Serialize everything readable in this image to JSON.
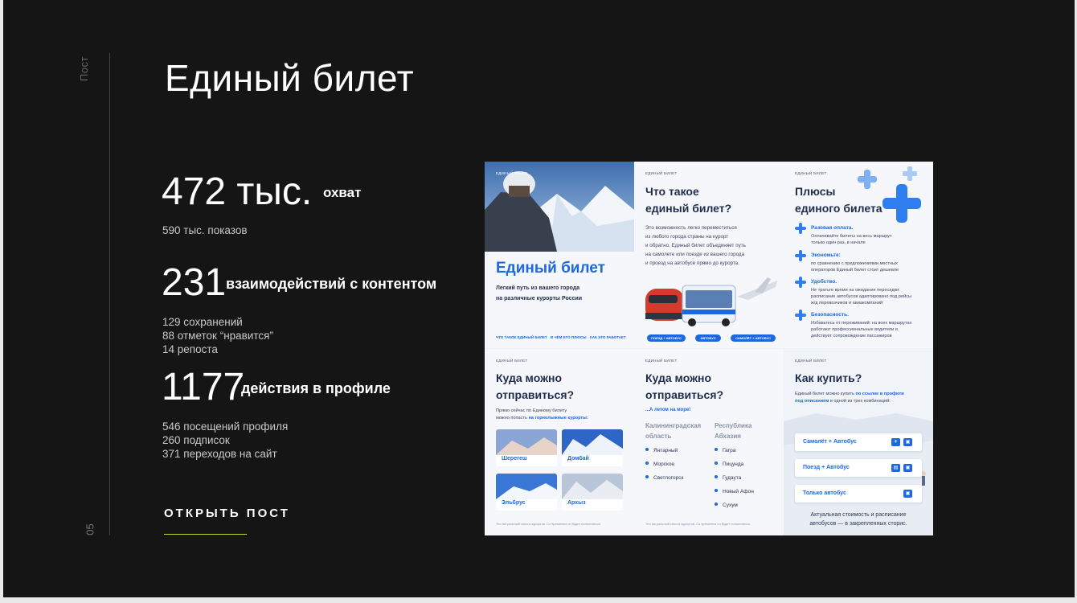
{
  "side": {
    "label": "Пост",
    "number": "05"
  },
  "title": "Единый билет",
  "stats": [
    {
      "value": "472 тыс.",
      "caption": "охват",
      "details": [
        "590 тыс. показов"
      ]
    },
    {
      "value": "231",
      "caption": "взаимодействий с контентом",
      "details": [
        "129 сохранений",
        "88 отметок “нравится”",
        "14 репоста"
      ]
    },
    {
      "value": "1177",
      "caption": "действия в профиле",
      "details": [
        "546 посещений профиля",
        "260 подписок",
        "371 переходов на сайт"
      ]
    }
  ],
  "open_post": "ОТКРЫТЬ ПОСТ",
  "colors": {
    "background": "#151515",
    "accent_underline": "#c6d639",
    "collage_blue": "#1b68e0"
  },
  "collage": {
    "tag": "ЕДИНЫЙ БИЛЕТ",
    "cover": {
      "title": "Единый билет",
      "subtitle_1": "Легкий путь из вашего города",
      "subtitle_2": "на различные курорты России",
      "links": [
        "ЧТО ТАКОЕ ЕДИНЫЙ БИЛЕТ",
        "В ЧЁМ ЕГО ПЛЮСЫ",
        "КАК ЭТО РАБОТАЕТ"
      ]
    },
    "what": {
      "heading_1": "Что такое",
      "heading_2": "единый билет?",
      "text": [
        "Это возможность легко переместиться",
        "из любого города страны на курорт",
        "и обратно. Единый билет объединяет путь",
        "на самолете или поезде из вашего города",
        "и проезд на автобусе прямо до курорта."
      ],
      "pills": [
        "ПОЕЗД + АВТОБУС",
        "АВТОБУС",
        "САМОЛЁТ + АВТОБУС"
      ]
    },
    "plus": {
      "heading_1": "Плюсы",
      "heading_2": "единого билета",
      "items": [
        {
          "title": "Разовая оплата.",
          "text": [
            "Оплачивайте билеты на весь маршрут",
            "только один раз, в начале"
          ]
        },
        {
          "title": "Экономьте:",
          "text": [
            "по сравнению с предложениями местных",
            "операторов Единый билет стоит дешевле"
          ]
        },
        {
          "title": "Удобство.",
          "text": [
            "Не тратьте время на ожидание пересадки:",
            "расписание автобусов адаптировано под рейсы",
            "ж/д перевозчиков и авиакомпаний"
          ]
        },
        {
          "title": "Безопасность.",
          "text": [
            "Избавьтесь от переживаний: на всех маршрутах",
            "работают профессиональные водители и",
            "действует сопровождение пассажиров"
          ]
        }
      ]
    },
    "where_mountains": {
      "heading_1": "Куда можно",
      "heading_2": "отправиться?",
      "text_1": "Прямо сейчас по Единому билету",
      "text_2": "можно попасть",
      "text_bold": "на горнолыжные курорты:",
      "places": [
        "Шерегеш",
        "Домбай",
        "Эльбрус",
        "Архыз"
      ],
      "footnote": "Это актуальный список курортов. Со временем он будет пополняться."
    },
    "where_sea": {
      "heading_1": "Куда можно",
      "heading_2": "отправиться?",
      "lead": "...А летом на море!",
      "col1_title_1": "Калининградская",
      "col1_title_2": "область",
      "col1": [
        "Янтарный",
        "Морское",
        "Светлогорск"
      ],
      "col2_title_1": "Республика",
      "col2_title_2": "Абхазия",
      "col2": [
        "Гагра",
        "Пицунда",
        "Гудаута",
        "Новый Афон",
        "Сухум"
      ],
      "footnote": "Это актуальный список курортов. Со временем он будет пополняться."
    },
    "buy": {
      "heading": "Как купить?",
      "text_1": "Единый билет можно купить",
      "text_link": "по ссылке в профиле",
      "text_2": "под описанием",
      "text_3": "в одной из трех комбинаций:",
      "options": [
        "Самолёт + Автобус",
        "Поезд + Автобус",
        "Только автобус"
      ],
      "note_1": "Актуальная стоимость и расписание",
      "note_2": "автобусов — в закрепленных сторис."
    }
  }
}
